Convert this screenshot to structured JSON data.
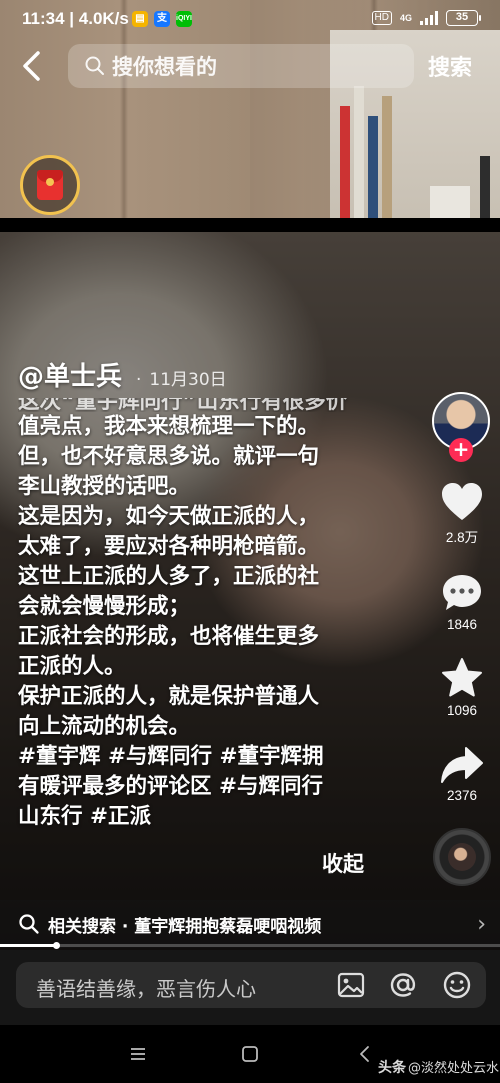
{
  "status_bar": {
    "time": "11:34",
    "speed": "4.0K/s",
    "network": "4G",
    "hd": "HD",
    "battery": "35",
    "app_icons": [
      "notes-app-icon",
      "alipay-icon",
      "iqiyi-icon"
    ]
  },
  "top_bar": {
    "search_placeholder": "搜你想看的",
    "search_button": "搜索"
  },
  "post": {
    "author": "@单士兵",
    "date": "11月30日",
    "caption_lines": [
      "这次“董宇辉同行”山东行有很多价",
      "值亮点，我本来想梳理一下的。",
      "但，也不好意思多说。就评一句",
      "李山教授的话吧。",
      "这是因为，如今天做正派的人，",
      "太难了，要应对各种明枪暗箭。",
      "这世上正派的人多了，正派的社",
      "会就会慢慢形成；",
      "正派社会的形成，也将催生更多",
      "正派的人。",
      "保护正派的人，就是保护普通人",
      "向上流动的机会。",
      "#董宇辉 #与辉同行 #董宇辉拥",
      "有暖评最多的评论区 #与辉同行",
      "山东行 #正派"
    ],
    "collapse_label": "收起"
  },
  "actions": {
    "likes": "2.8万",
    "comments": "1846",
    "favorites": "1096",
    "shares": "2376"
  },
  "related_search": {
    "text": "相关搜索 · 董宇辉拥抱蔡磊哽咽视频"
  },
  "progress_fraction": 0.114,
  "comment_bar": {
    "placeholder": "善语结善缘，恶言伤人心"
  },
  "watermark": {
    "brand": "头条",
    "handle": "@淡然处处云水间L"
  },
  "colors": {
    "follow_red": "#fe2c55",
    "redpacket_ring": "#f2c24f"
  }
}
